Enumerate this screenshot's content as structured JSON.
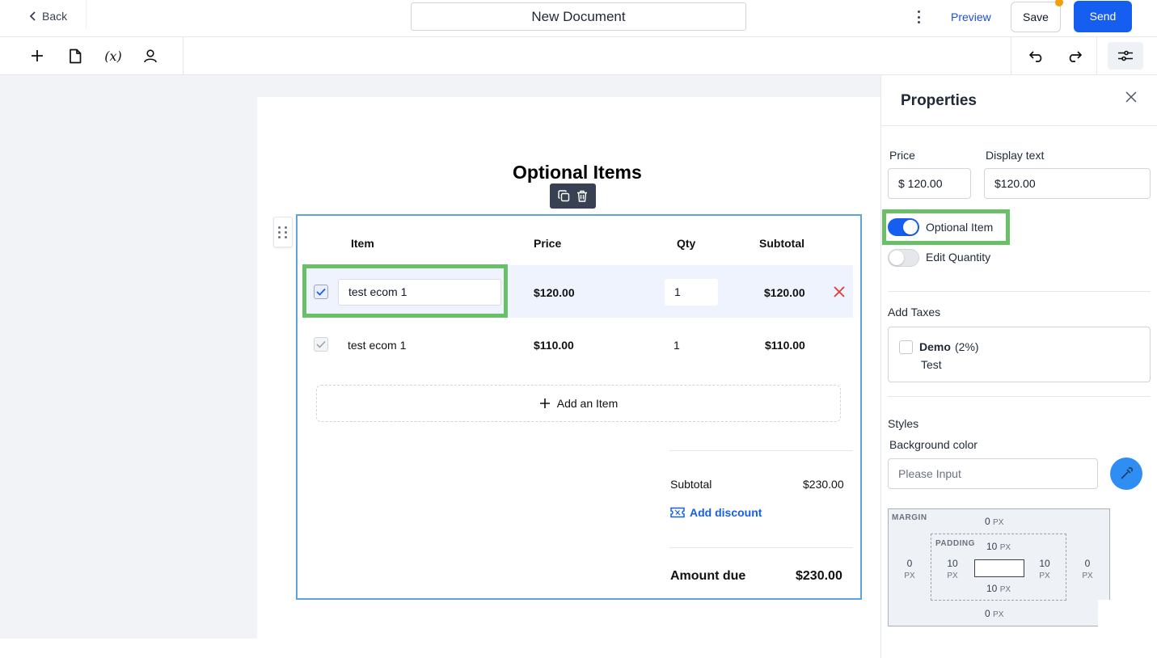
{
  "header": {
    "back_label": "Back",
    "document_title": "New Document",
    "preview_label": "Preview",
    "save_label": "Save",
    "send_label": "Send"
  },
  "toolbar": {
    "tools": [
      "add-icon",
      "page-icon",
      "variable-icon",
      "user-icon"
    ],
    "variable_label": "(x)",
    "right_tools": [
      "undo-icon",
      "redo-icon",
      "settings-sliders-icon"
    ]
  },
  "section": {
    "title": "Optional Items",
    "columns": {
      "item": "Item",
      "price": "Price",
      "qty": "Qty",
      "subtotal": "Subtotal"
    },
    "rows": [
      {
        "checked": true,
        "name": "test ecom 1",
        "price": "$120.00",
        "qty": "1",
        "subtotal": "$120.00",
        "selected": true
      },
      {
        "checked": true,
        "name": "test ecom 1",
        "price": "$110.00",
        "qty": "1",
        "subtotal": "$110.00",
        "selected": false
      }
    ],
    "add_item_label": "Add an Item",
    "totals": {
      "subtotal_label": "Subtotal",
      "subtotal_value": "$230.00",
      "add_discount_label": "Add discount",
      "amount_due_label": "Amount due",
      "amount_due_value": "$230.00"
    }
  },
  "properties": {
    "title": "Properties",
    "price_label": "Price",
    "price_value": "$ 120.00",
    "display_text_label": "Display text",
    "display_text_value": "$120.00",
    "optional_item": {
      "label": "Optional Item",
      "on": true
    },
    "edit_quantity": {
      "label": "Edit Quantity",
      "on": false
    },
    "add_taxes_label": "Add Taxes",
    "tax": {
      "name": "Demo",
      "rate": "(2%)",
      "description": "Test",
      "checked": false
    },
    "styles_label": "Styles",
    "background_color_label": "Background color",
    "background_color_placeholder": "Please Input",
    "box_model": {
      "margin_label": "MARGIN",
      "padding_label": "PADDING",
      "unit": "PX",
      "margin": {
        "top": "0",
        "right": "0",
        "bottom": "0",
        "left": "0"
      },
      "padding": {
        "top": "10",
        "right": "10",
        "bottom": "10",
        "left": "10"
      }
    }
  },
  "colors": {
    "accent": "#155eef",
    "highlight": "#6abf69",
    "selection_border": "#5ea3e0",
    "delete": "#e53935"
  }
}
